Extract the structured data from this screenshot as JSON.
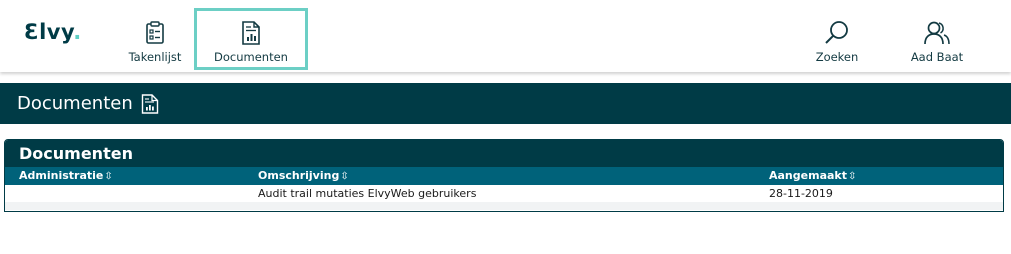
{
  "app": {
    "logo_text": "Ɛlvy",
    "logo_dot": "."
  },
  "nav": {
    "takenlijst": {
      "label": "Takenlijst",
      "icon": "clipboard-list-icon"
    },
    "documenten": {
      "label": "Documenten",
      "icon": "document-chart-icon",
      "active": true
    },
    "zoeken": {
      "label": "Zoeken",
      "icon": "search-icon"
    },
    "user": {
      "label": "Aad Baat",
      "icon": "users-icon"
    }
  },
  "page": {
    "title": "Documenten",
    "icon": "document-chart-icon"
  },
  "panel": {
    "title": "Documenten",
    "columns": [
      {
        "label": "Administratie",
        "sort_icon": "⇳"
      },
      {
        "label": "Omschrijving",
        "sort_icon": "⇳"
      },
      {
        "label": "Aangemaakt",
        "sort_icon": "⇳"
      }
    ],
    "rows": [
      {
        "administratie": "",
        "omschrijving": "Audit trail mutaties ElvyWeb gebruikers",
        "aangemaakt": "28-11-2019"
      }
    ]
  },
  "colors": {
    "primary": "#003b46",
    "header_row": "#00627a",
    "accent": "#6ccfc5"
  }
}
